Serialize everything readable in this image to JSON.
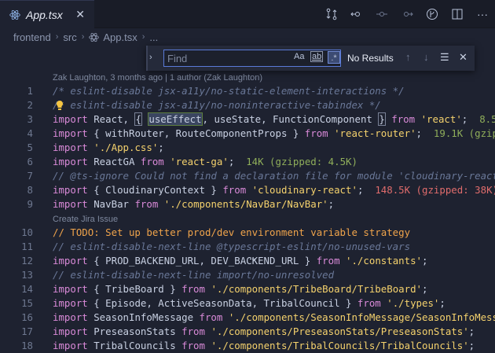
{
  "tab": {
    "title": "App.tsx",
    "close": "✕"
  },
  "toolbar": {
    "more": "···"
  },
  "breadcrumb": [
    "frontend",
    "src",
    "App.tsx",
    "..."
  ],
  "find": {
    "placeholder": "Find",
    "match_case": "Aa",
    "whole_word": "ab",
    "regex": ".*",
    "result": "No Results"
  },
  "blame": "Zak Laughton, 3 months ago | 1 author (Zak Laughton)",
  "jira_lens": "Create Jira Issue",
  "lines": [
    {
      "n": "1",
      "segs": [
        [
          "c",
          "/* eslint-disable jsx-a11y/no-static-element-interactions */"
        ]
      ]
    },
    {
      "n": "2",
      "segs": [
        [
          "c",
          "/* eslint-disable jsx-a11y/no-noninteractive-tabindex */"
        ]
      ]
    },
    {
      "n": "3",
      "segs": [
        [
          "k",
          "import"
        ],
        [
          "p",
          " React, "
        ],
        [
          "br",
          "{"
        ],
        [
          "p",
          " "
        ],
        [
          "hl",
          "useEffect"
        ],
        [
          "p",
          ", useState, FunctionComponent "
        ],
        [
          "br",
          "}"
        ],
        [
          "p",
          " "
        ],
        [
          "k",
          "from"
        ],
        [
          "p",
          " "
        ],
        [
          "s",
          "'react'"
        ],
        [
          "p",
          ";  "
        ],
        [
          "imp",
          "8.5K"
        ]
      ]
    },
    {
      "n": "4",
      "segs": [
        [
          "k",
          "import"
        ],
        [
          "p",
          " { withRouter, RouteComponentProps } "
        ],
        [
          "k",
          "from"
        ],
        [
          "p",
          " "
        ],
        [
          "s",
          "'react-router'"
        ],
        [
          "p",
          ";  "
        ],
        [
          "imp",
          "19.1K (gzip"
        ]
      ]
    },
    {
      "n": "5",
      "segs": [
        [
          "k",
          "import"
        ],
        [
          "p",
          " "
        ],
        [
          "s",
          "'./App.css'"
        ],
        [
          "p",
          ";"
        ]
      ]
    },
    {
      "n": "6",
      "segs": [
        [
          "k",
          "import"
        ],
        [
          "p",
          " ReactGA "
        ],
        [
          "k",
          "from"
        ],
        [
          "p",
          " "
        ],
        [
          "s",
          "'react-ga'"
        ],
        [
          "p",
          ";  "
        ],
        [
          "imp",
          "14K (gzipped: 4.5K)"
        ]
      ]
    },
    {
      "n": "7",
      "segs": [
        [
          "c",
          "// @ts-ignore Could not find a declaration file for module 'cloudinary-react"
        ]
      ]
    },
    {
      "n": "8",
      "segs": [
        [
          "k",
          "import"
        ],
        [
          "p",
          " { CloudinaryContext } "
        ],
        [
          "k",
          "from"
        ],
        [
          "p",
          " "
        ],
        [
          "s",
          "'cloudinary-react'"
        ],
        [
          "p",
          ";  "
        ],
        [
          "impred",
          "148.5K (gzipped: 38K)"
        ]
      ]
    },
    {
      "n": "9",
      "segs": [
        [
          "k",
          "import"
        ],
        [
          "p",
          " NavBar "
        ],
        [
          "k",
          "from"
        ],
        [
          "p",
          " "
        ],
        [
          "s",
          "'./components/NavBar/NavBar'"
        ],
        [
          "p",
          ";"
        ]
      ]
    },
    {
      "n": "10",
      "segs": [
        [
          "todo",
          "// TODO: Set up better prod/dev environment variable strategy"
        ]
      ]
    },
    {
      "n": "11",
      "segs": [
        [
          "c",
          "// eslint-disable-next-line @typescript-eslint/no-unused-vars"
        ]
      ]
    },
    {
      "n": "12",
      "segs": [
        [
          "k",
          "import"
        ],
        [
          "p",
          " { PROD_BACKEND_URL, DEV_BACKEND_URL } "
        ],
        [
          "k",
          "from"
        ],
        [
          "p",
          " "
        ],
        [
          "s",
          "'./constants'"
        ],
        [
          "p",
          ";"
        ]
      ]
    },
    {
      "n": "13",
      "segs": [
        [
          "c",
          "// eslint-disable-next-line import/no-unresolved"
        ]
      ]
    },
    {
      "n": "14",
      "segs": [
        [
          "k",
          "import"
        ],
        [
          "p",
          " { TribeBoard } "
        ],
        [
          "k",
          "from"
        ],
        [
          "p",
          " "
        ],
        [
          "s",
          "'./components/TribeBoard/TribeBoard'"
        ],
        [
          "p",
          ";"
        ]
      ]
    },
    {
      "n": "15",
      "segs": [
        [
          "k",
          "import"
        ],
        [
          "p",
          " { Episode, ActiveSeasonData, TribalCouncil } "
        ],
        [
          "k",
          "from"
        ],
        [
          "p",
          " "
        ],
        [
          "s",
          "'./types'"
        ],
        [
          "p",
          ";"
        ]
      ]
    },
    {
      "n": "16",
      "segs": [
        [
          "k",
          "import"
        ],
        [
          "p",
          " SeasonInfoMessage "
        ],
        [
          "k",
          "from"
        ],
        [
          "p",
          " "
        ],
        [
          "s",
          "'./components/SeasonInfoMessage/SeasonInfoMess"
        ]
      ]
    },
    {
      "n": "17",
      "segs": [
        [
          "k",
          "import"
        ],
        [
          "p",
          " PreseasonStats "
        ],
        [
          "k",
          "from"
        ],
        [
          "p",
          " "
        ],
        [
          "s",
          "'./components/PreseasonStats/PreseasonStats'"
        ],
        [
          "p",
          ";"
        ]
      ]
    },
    {
      "n": "18",
      "segs": [
        [
          "k",
          "import"
        ],
        [
          "p",
          " TribalCouncils "
        ],
        [
          "k",
          "from"
        ],
        [
          "p",
          " "
        ],
        [
          "s",
          "'./components/TribalCouncils/TribalCouncils'"
        ],
        [
          "p",
          ";"
        ]
      ]
    }
  ]
}
